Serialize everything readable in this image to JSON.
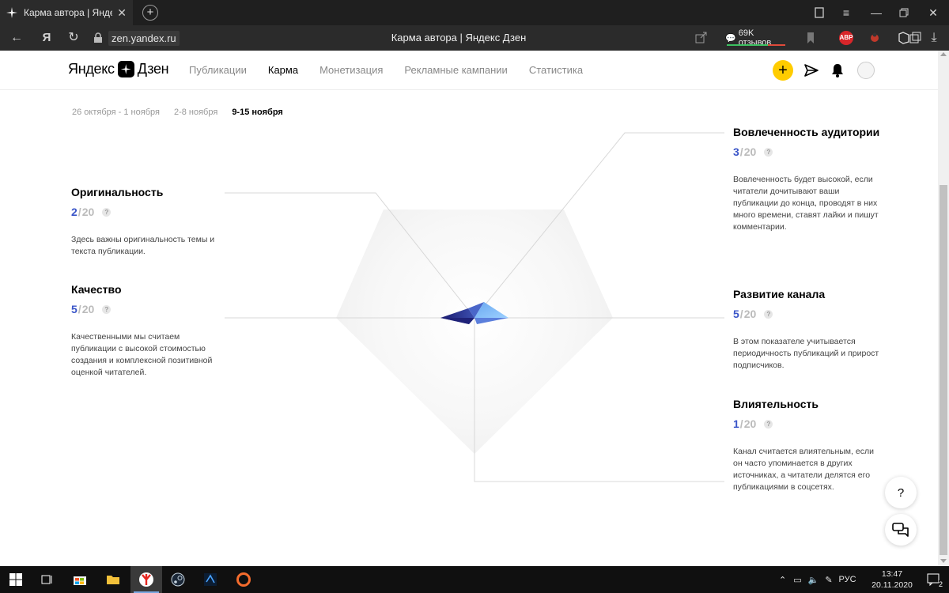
{
  "browser": {
    "tab_title": "Карма автора | Яндекс",
    "url": "zen.yandex.ru",
    "page_title": "Карма автора | Яндекс Дзен",
    "reviews_badge": "69K отзывов",
    "abp_label": "ABP",
    "yandex_letter": "Я"
  },
  "header": {
    "logo_left": "Яндекс",
    "logo_right": "Дзен",
    "nav": [
      {
        "label": "Публикации",
        "active": false
      },
      {
        "label": "Карма",
        "active": true
      },
      {
        "label": "Монетизация",
        "active": false
      },
      {
        "label": "Рекламные кампании",
        "active": false
      },
      {
        "label": "Статистика",
        "active": false
      }
    ],
    "plus_label": "+"
  },
  "weeks": [
    {
      "label": "26 октября - 1 ноября",
      "active": false
    },
    {
      "label": "2-8 ноября",
      "active": false
    },
    {
      "label": "9-15 ноября",
      "active": true
    }
  ],
  "metrics": {
    "originality": {
      "title": "Оригинальность",
      "score": "2",
      "max": "20",
      "desc": "Здесь важны оригинальность темы и текста публикации."
    },
    "quality": {
      "title": "Качество",
      "score": "5",
      "max": "20",
      "desc": "Качественными мы считаем публикации с высокой стоимостью создания и комплексной позитивной оценкой читателей."
    },
    "engagement": {
      "title": "Вовлеченность аудитории",
      "score": "3",
      "max": "20",
      "desc": "Вовлеченность будет высокой, если читатели дочитывают ваши публикации до конца, проводят в них много времени, ставят лайки и пишут комментарии."
    },
    "growth": {
      "title": "Развитие канала",
      "score": "5",
      "max": "20",
      "desc": "В этом показателе учитывается периодичность публикаций и прирост подписчиков."
    },
    "influence": {
      "title": "Влиятельность",
      "score": "1",
      "max": "20",
      "desc": "Канал считается влиятельным, если он часто упоминается в других источниках, а читатели делятся его публикациями в соцсетях."
    }
  },
  "help_button": "?",
  "taskbar": {
    "lang": "РУС",
    "time": "13:47",
    "date": "20.11.2020",
    "notifications": "2"
  },
  "colors": {
    "accent_yellow": "#ffcc00",
    "score_blue": "#3a55c8",
    "chrome_dark": "#2b2b2b"
  }
}
